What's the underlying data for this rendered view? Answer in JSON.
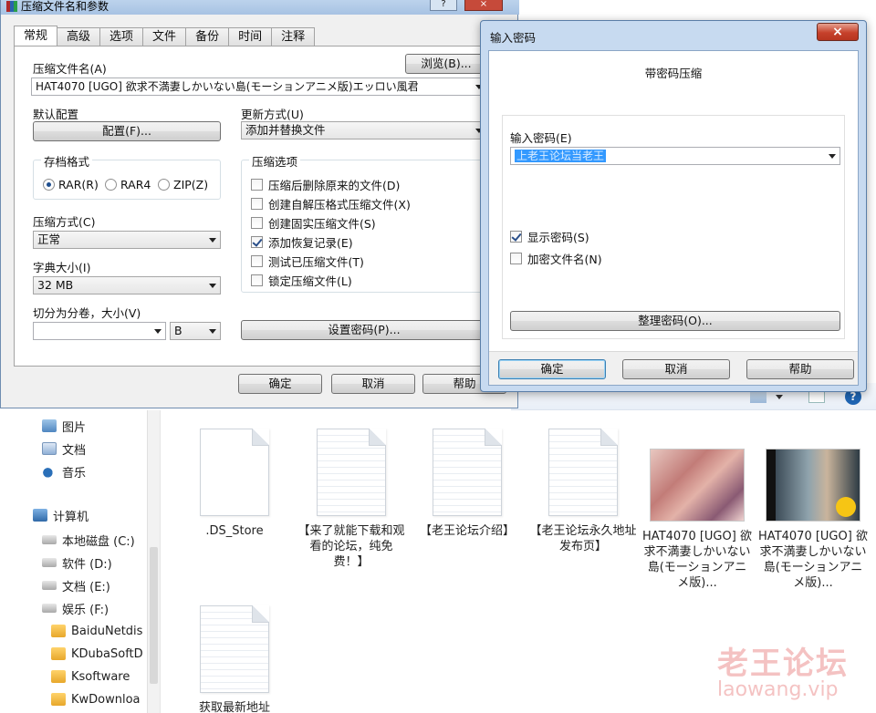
{
  "main_dialog": {
    "title": "压缩文件名和参数",
    "title_help": "?",
    "title_close": "×",
    "tabs": [
      "常规",
      "高级",
      "选项",
      "文件",
      "备份",
      "时间",
      "注释"
    ],
    "archive_name_label": "压缩文件名(A)",
    "browse_button": "浏览(B)...",
    "archive_name_value": "HAT4070 [UGO] 欲求不満妻しかいない島(モーションアニメ版)エッロい風君",
    "profile_label": "默认配置",
    "profile_button": "配置(F)...",
    "update_mode_label": "更新方式(U)",
    "update_mode_value": "添加并替换文件",
    "format_group_title": "存档格式",
    "formats": [
      "RAR(R)",
      "RAR4",
      "ZIP(Z)"
    ],
    "selected_format": "RAR(R)",
    "method_label": "压缩方式(C)",
    "method_value": "正常",
    "dict_label": "字典大小(I)",
    "dict_value": "32 MB",
    "split_label": "切分为分卷，大小(V)",
    "split_value": "",
    "split_unit": "B",
    "options_group_title": "压缩选项",
    "options": [
      {
        "label": "压缩后删除原来的文件(D)",
        "checked": false
      },
      {
        "label": "创建自解压格式压缩文件(X)",
        "checked": false
      },
      {
        "label": "创建固实压缩文件(S)",
        "checked": false
      },
      {
        "label": "添加恢复记录(E)",
        "checked": true
      },
      {
        "label": "测试已压缩文件(T)",
        "checked": false
      },
      {
        "label": "锁定压缩文件(L)",
        "checked": false
      }
    ],
    "set_password_button": "设置密码(P)...",
    "ok_button": "确定",
    "cancel_button": "取消",
    "help_button": "帮助"
  },
  "password_dialog": {
    "title": "输入密码",
    "close": "×",
    "heading": "带密码压缩",
    "password_label": "输入密码(E)",
    "password_value": "上老王论坛当老王",
    "show_password_label": "显示密码(S)",
    "show_password_checked": true,
    "encrypt_names_label": "加密文件名(N)",
    "encrypt_names_checked": false,
    "organize_button": "整理密码(O)...",
    "ok_button": "确定",
    "cancel_button": "取消",
    "help_button": "帮助"
  },
  "explorer": {
    "nav_items": [
      {
        "label": "图片",
        "icon": "picture-icon"
      },
      {
        "label": "文档",
        "icon": "document-icon"
      },
      {
        "label": "音乐",
        "icon": "music-icon"
      },
      {
        "label": "计算机",
        "icon": "computer-icon"
      },
      {
        "label": "本地磁盘 (C:)",
        "icon": "drive-icon"
      },
      {
        "label": "软件 (D:)",
        "icon": "drive-icon"
      },
      {
        "label": "文档 (E:)",
        "icon": "drive-icon"
      },
      {
        "label": "娱乐 (F:)",
        "icon": "drive-icon"
      },
      {
        "label": "BaiduNetdis",
        "icon": "folder-icon"
      },
      {
        "label": "KDubaSoftD",
        "icon": "folder-icon"
      },
      {
        "label": "Ksoftware",
        "icon": "folder-icon"
      },
      {
        "label": "KwDownloa",
        "icon": "folder-icon"
      }
    ],
    "files": [
      {
        "name": ".DS_Store",
        "kind": "blank"
      },
      {
        "name": "【来了就能下载和观看的论坛，纯免费！】",
        "kind": "lined"
      },
      {
        "name": "【老王论坛介绍】",
        "kind": "lined"
      },
      {
        "name": "【老王论坛永久地址发布页】",
        "kind": "lined"
      },
      {
        "name": "HAT4070 [UGO] 欲求不満妻しかいない島(モーションアニメ版)...",
        "kind": "image"
      },
      {
        "name": "HAT4070 [UGO] 欲求不満妻しかいない島(モーションアニメ版)...",
        "kind": "video"
      },
      {
        "name": "获取最新地址",
        "kind": "lined"
      }
    ]
  },
  "watermark": {
    "main": "老王论坛",
    "sub": "laowang.vip"
  }
}
